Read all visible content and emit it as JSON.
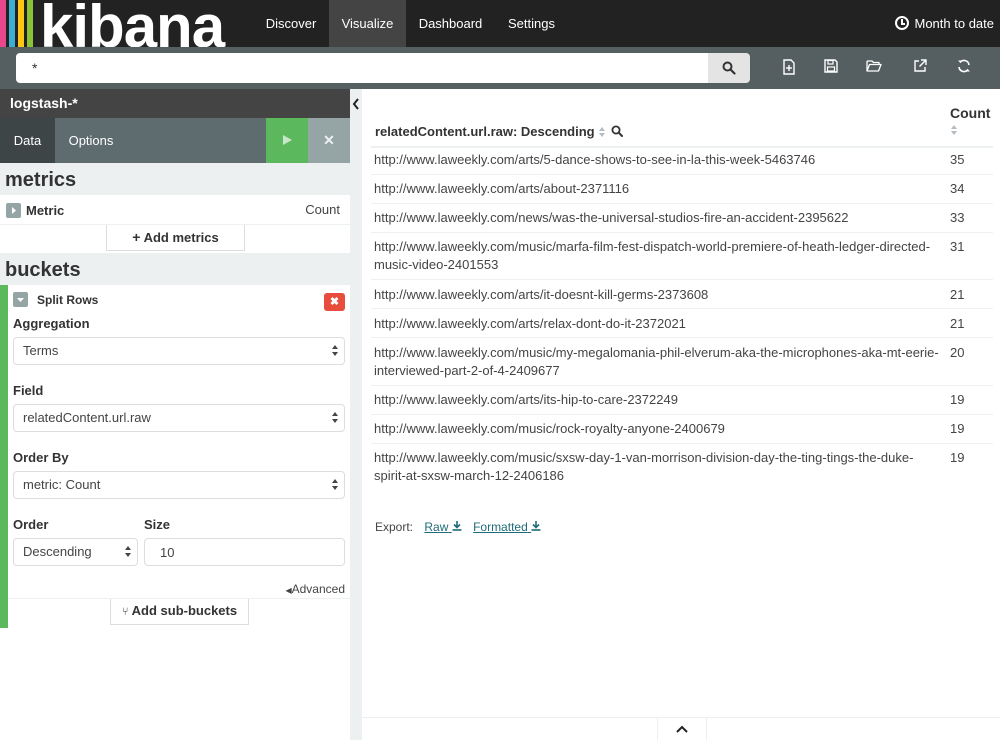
{
  "app": {
    "logo_text": "kibana",
    "logo_stripe_colors": [
      "#e8488b",
      "#3caed2",
      "#fec514",
      "#8ac336"
    ]
  },
  "nav": {
    "items": [
      {
        "label": "Discover"
      },
      {
        "label": "Visualize",
        "active": true
      },
      {
        "label": "Dashboard"
      },
      {
        "label": "Settings"
      }
    ],
    "time_label": "Month to date"
  },
  "search": {
    "query": "*"
  },
  "toolbar": {
    "icons": [
      "new-visualization-icon",
      "save-icon",
      "open-icon",
      "share-icon",
      "refresh-icon"
    ]
  },
  "sidebar": {
    "index_pattern": "logstash-*",
    "tabs": [
      {
        "label": "Data",
        "active": true
      },
      {
        "label": "Options"
      }
    ],
    "metrics_header": "metrics",
    "metric": {
      "label": "Metric",
      "value": "Count"
    },
    "add_metrics_label": "Add metrics",
    "buckets_header": "buckets",
    "bucket": {
      "title": "Split Rows",
      "aggregation_label": "Aggregation",
      "aggregation_value": "Terms",
      "field_label": "Field",
      "field_value": "relatedContent.url.raw",
      "order_by_label": "Order By",
      "order_by_value": "metric: Count",
      "order_label": "Order",
      "order_value": "Descending",
      "size_label": "Size",
      "size_value": "10",
      "advanced_label": "Advanced"
    },
    "add_sub_buckets_label": "Add sub-buckets"
  },
  "table": {
    "col_term": "relatedContent.url.raw: Descending",
    "col_count": "Count",
    "rows": [
      {
        "url": "http://www.laweekly.com/arts/5-dance-shows-to-see-in-la-this-week-5463746",
        "count": "35"
      },
      {
        "url": "http://www.laweekly.com/arts/about-2371116",
        "count": "34"
      },
      {
        "url": "http://www.laweekly.com/news/was-the-universal-studios-fire-an-accident-2395622",
        "count": "33"
      },
      {
        "url": "http://www.laweekly.com/music/marfa-film-fest-dispatch-world-premiere-of-heath-ledger-directed-music-video-2401553",
        "count": "31"
      },
      {
        "url": "http://www.laweekly.com/arts/it-doesnt-kill-germs-2373608",
        "count": "21"
      },
      {
        "url": "http://www.laweekly.com/arts/relax-dont-do-it-2372021",
        "count": "21"
      },
      {
        "url": "http://www.laweekly.com/music/my-megalomania-phil-elverum-aka-the-microphones-aka-mt-eerie-interviewed-part-2-of-4-2409677",
        "count": "20"
      },
      {
        "url": "http://www.laweekly.com/arts/its-hip-to-care-2372249",
        "count": "19"
      },
      {
        "url": "http://www.laweekly.com/music/rock-royalty-anyone-2400679",
        "count": "19"
      },
      {
        "url": "http://www.laweekly.com/music/sxsw-day-1-van-morrison-division-day-the-ting-tings-the-duke-spirit-at-sxsw-march-12-2406186",
        "count": "19"
      }
    ],
    "export_label": "Export:",
    "export_raw": "Raw",
    "export_formatted": "Formatted"
  }
}
